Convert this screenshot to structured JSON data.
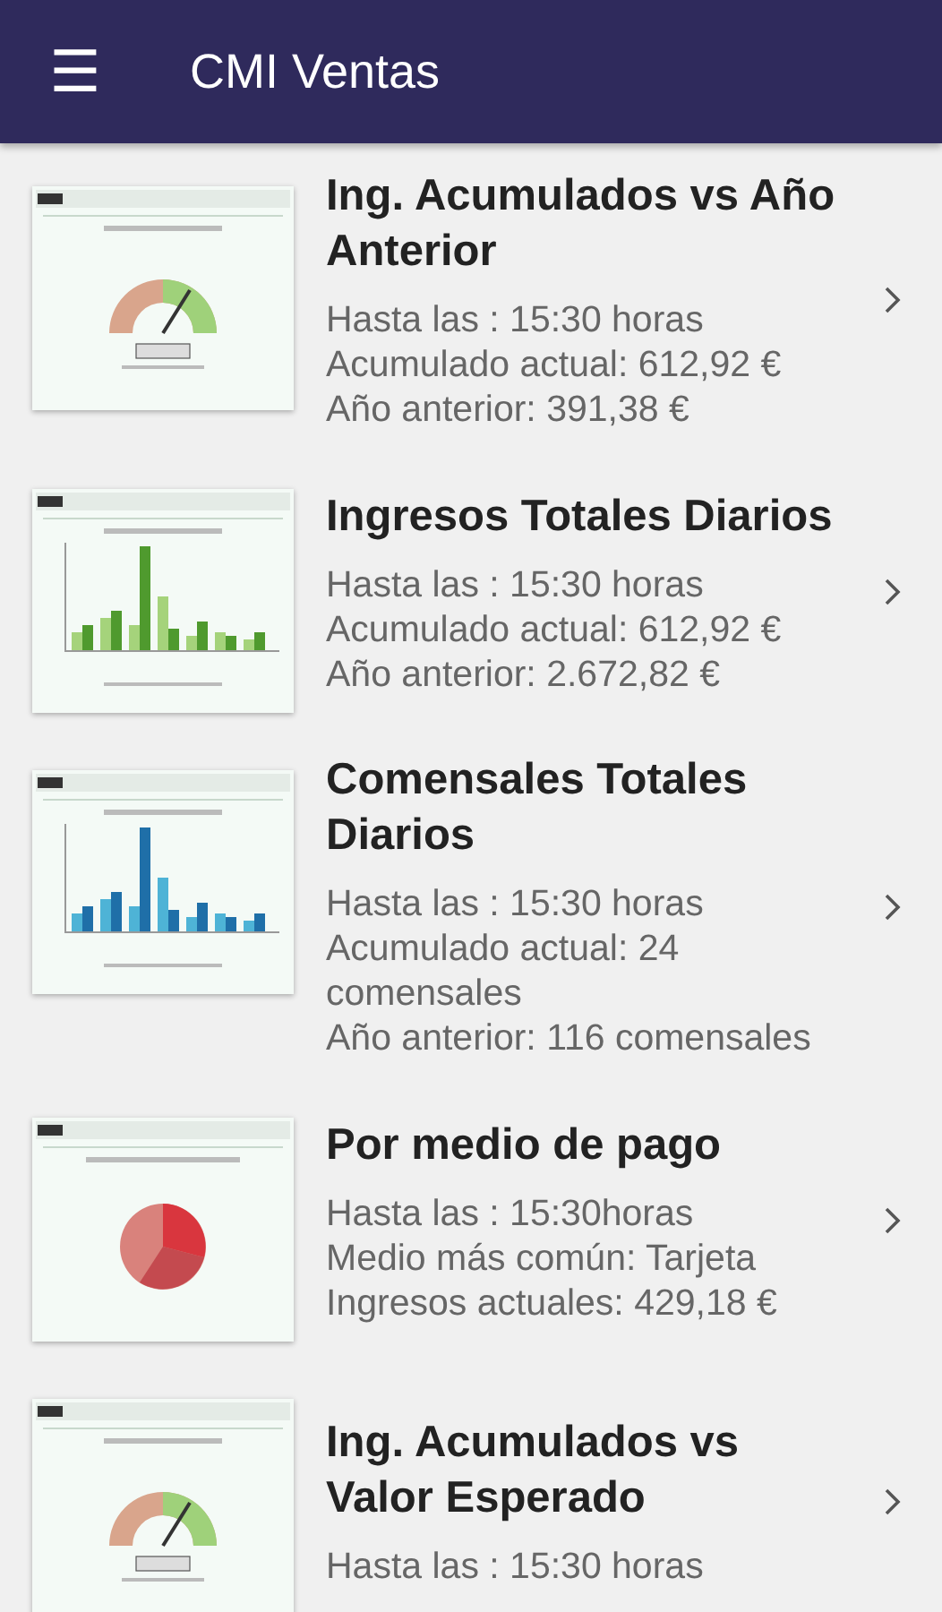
{
  "app_bar": {
    "menu_icon": "☰",
    "title": "CMI Ventas"
  },
  "items": [
    {
      "kind": "gauge",
      "title": "Ing. Acumulados vs Año Anterior",
      "lines": [
        "Hasta las : 15:30 horas",
        "Acumulado actual: 612,92 €",
        "Año anterior: 391,38 €"
      ]
    },
    {
      "kind": "bars_green",
      "title": "Ingresos Totales Diarios",
      "lines": [
        "Hasta las : 15:30 horas",
        "Acumulado actual: 612,92 €",
        "Año anterior: 2.672,82 €"
      ]
    },
    {
      "kind": "bars_blue",
      "title": "Comensales Totales Diarios",
      "lines": [
        "Hasta las : 15:30 horas",
        "Acumulado actual: 24 comensales",
        "Año anterior: 116 comensales"
      ]
    },
    {
      "kind": "pie",
      "title": "Por medio de pago",
      "lines": [
        "Hasta las : 15:30horas",
        "Medio más común: Tarjeta",
        "Ingresos actuales: 429,18 €"
      ]
    },
    {
      "kind": "gauge",
      "title": "Ing. Acumulados vs Valor Esperado",
      "lines": [
        "Hasta las : 15:30 horas"
      ]
    }
  ]
}
